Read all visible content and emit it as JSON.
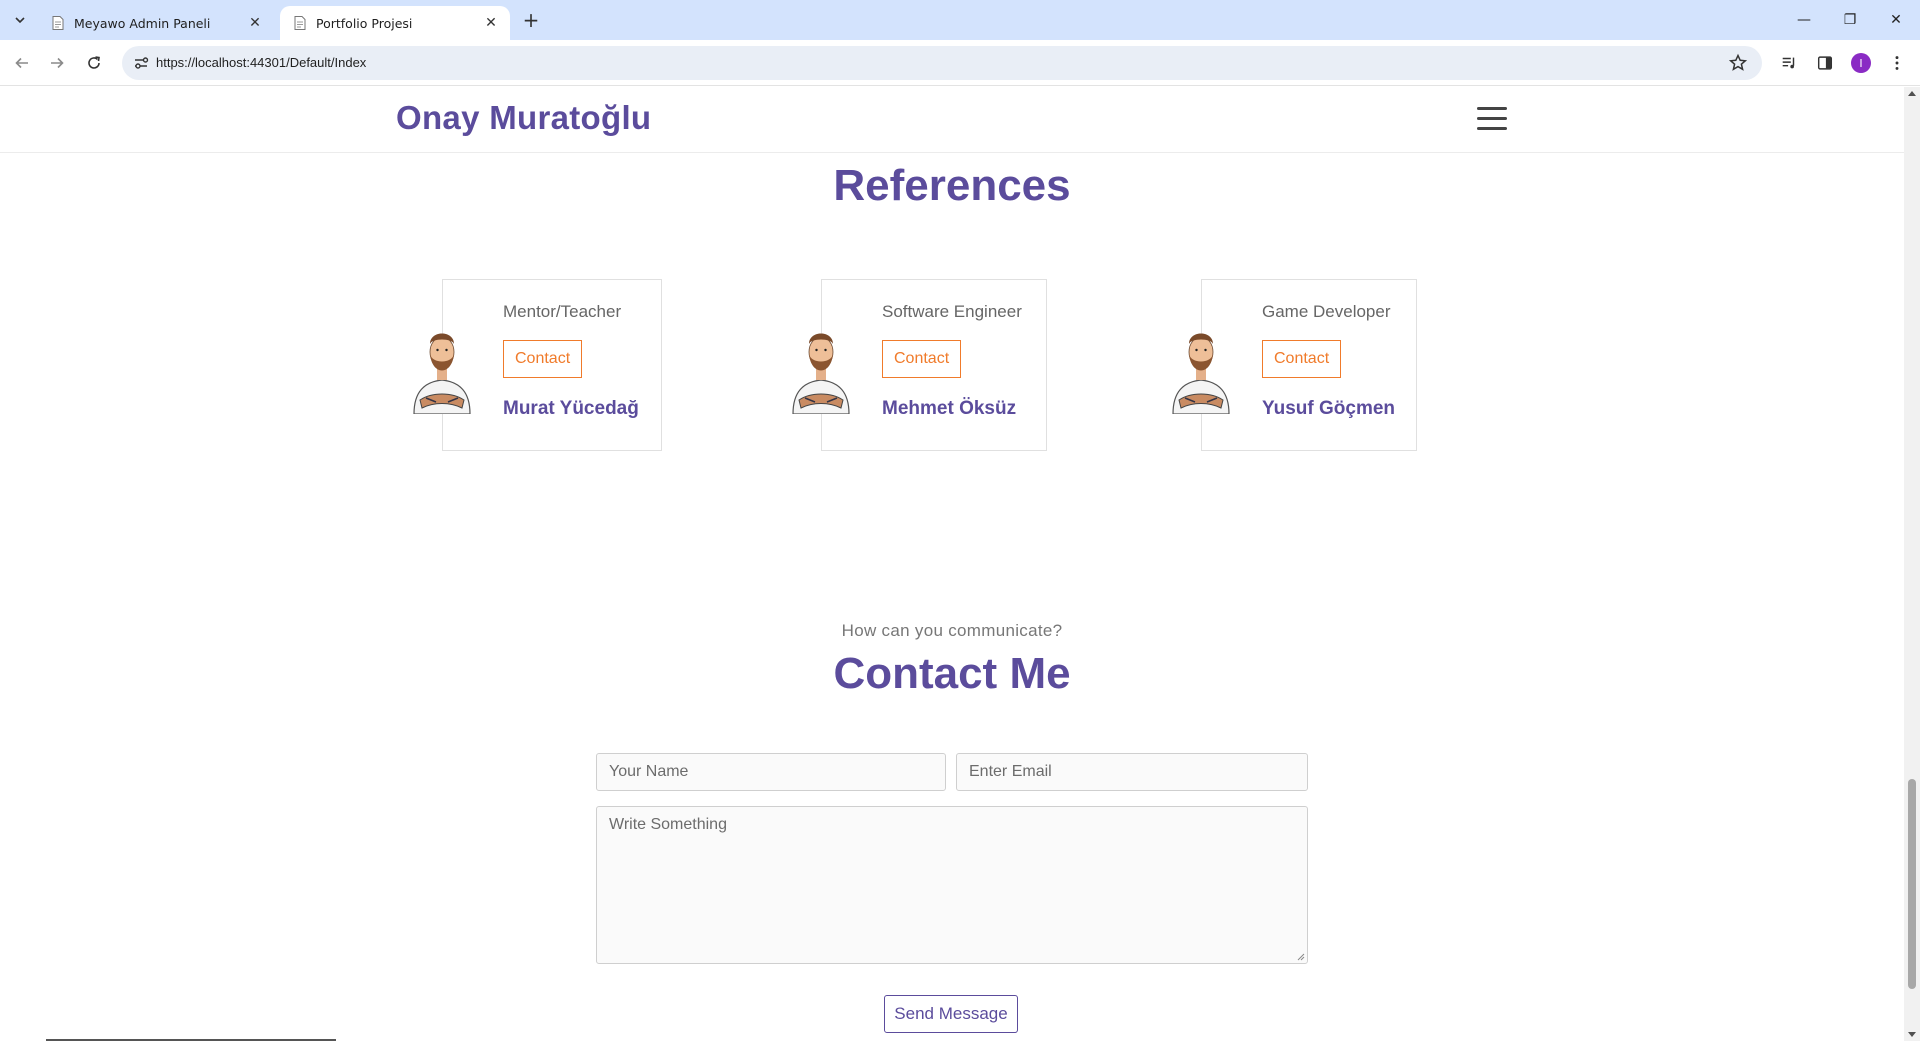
{
  "browser": {
    "tabs": [
      {
        "title": "Meyawo Admin Paneli",
        "active": false
      },
      {
        "title": "Portfolio Projesi",
        "active": true
      }
    ],
    "new_tab_symbol": "+",
    "close_symbol": "✕",
    "url": "https://localhost:44301/Default/Index",
    "profile_initial": "I",
    "window_controls": {
      "minimize": "—",
      "restore": "❐",
      "close": "✕"
    }
  },
  "site": {
    "brand": "Onay Muratoğlu",
    "references_title": "References",
    "references": [
      {
        "role": "Mentor/Teacher",
        "contact_label": "Contact",
        "name": "Murat Yücedağ"
      },
      {
        "role": "Software Engineer",
        "contact_label": "Contact",
        "name": "Mehmet Öksüz"
      },
      {
        "role": "Game Developer",
        "contact_label": "Contact",
        "name": "Yusuf Göçmen"
      }
    ],
    "contact": {
      "subtitle": "How can you communicate?",
      "title": "Contact Me",
      "name_placeholder": "Your Name",
      "email_placeholder": "Enter Email",
      "message_placeholder": "Write Something",
      "send_label": "Send Message"
    }
  },
  "colors": {
    "brand_purple": "#5b4c9c",
    "accent_orange": "#f07b2b",
    "chrome_tabbar": "#d3e3fd"
  },
  "icons": [
    "tab-list-icon",
    "document-favicon-icon",
    "back-icon",
    "forward-icon",
    "reload-icon",
    "site-info-icon",
    "star-icon",
    "media-icon",
    "side-panel-icon",
    "menu-dots-icon",
    "hamburger-icon",
    "avatar-icon"
  ]
}
